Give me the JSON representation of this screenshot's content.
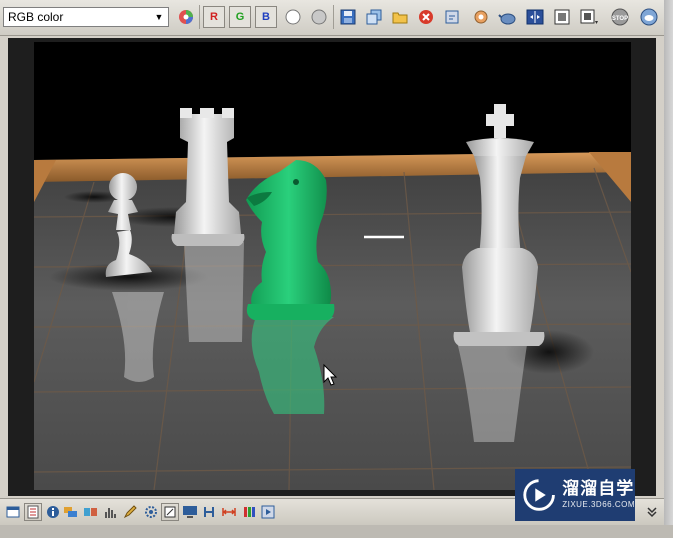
{
  "toolbar": {
    "channel_select": "RGB color",
    "channel_red": "R",
    "channel_green": "G",
    "channel_blue": "B"
  },
  "watermark": {
    "title": "溜溜自学",
    "subtitle": "ZIXUE.3D66.COM"
  },
  "colors": {
    "toolbar_bg": "#d4d0c8",
    "watermark_bg": "#1f3d72",
    "knight_green": "#1fbf6a"
  }
}
